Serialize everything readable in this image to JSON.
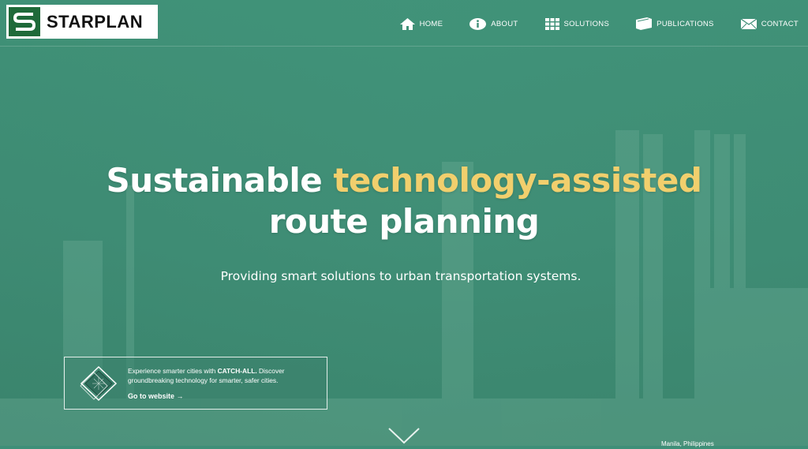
{
  "brand": {
    "name": "STARPLAN",
    "mark_color": "#1f6a3a"
  },
  "nav": {
    "items": [
      {
        "label": "HOME",
        "icon": "home-icon"
      },
      {
        "label": "ABOUT",
        "icon": "info-icon"
      },
      {
        "label": "SOLUTIONS",
        "icon": "grid-icon"
      },
      {
        "label": "PUBLICATIONS",
        "icon": "folder-icon"
      },
      {
        "label": "CONTACT",
        "icon": "envelope-icon"
      }
    ]
  },
  "hero": {
    "headline_part1": "Sustainable ",
    "headline_accent": "technology-assisted",
    "headline_part2": "route planning",
    "subtitle": "Providing smart solutions to urban transportation systems.",
    "accent_color": "#f1cf6d"
  },
  "promo": {
    "text_before": "Experience smarter cities with ",
    "text_bold": "CATCH-ALL.",
    "text_after": " Discover groundbreaking technology for smarter, safer cities.",
    "link_label": "Go to website",
    "link_arrow": "→",
    "icon": "catch-all-logo-icon"
  },
  "footer": {
    "scroll_icon": "chevron-down-icon",
    "location": "Manila, Philippines"
  }
}
